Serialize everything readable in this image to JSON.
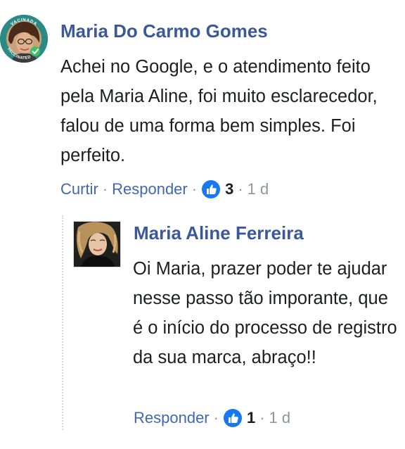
{
  "comment": {
    "author": "Maria Do Carmo Gomes",
    "text": "Achei no Google, e o atendimento feito pela Maria Aline, foi muito esclarecedor, falou de uma forma bem simples. Foi perfeito.",
    "actions": {
      "like_label": "Curtir",
      "reply_label": "Responder",
      "separator": "·",
      "like_count": "3",
      "time": "1 d"
    }
  },
  "reply": {
    "author": "Maria Aline Ferreira",
    "text": "Oi Maria, prazer poder te ajudar nesse passo tão imporante, que é o início do processo de registro da sua marca, abraço!!",
    "actions": {
      "reply_label": "Responder",
      "separator": "·",
      "like_count": "1",
      "time": "1 d"
    }
  },
  "avatar_badge": {
    "top_text": "VACINADA",
    "bottom_text": "VACCINATED"
  },
  "colors": {
    "link": "#4267b2",
    "author": "#3b5998",
    "text": "#1c1e21",
    "muted": "#90949c",
    "like_badge": "#1877f2",
    "badge_ring": "#2b8a83"
  },
  "icons": {
    "like": "thumbs-up-icon",
    "badge_check": "check-icon"
  }
}
